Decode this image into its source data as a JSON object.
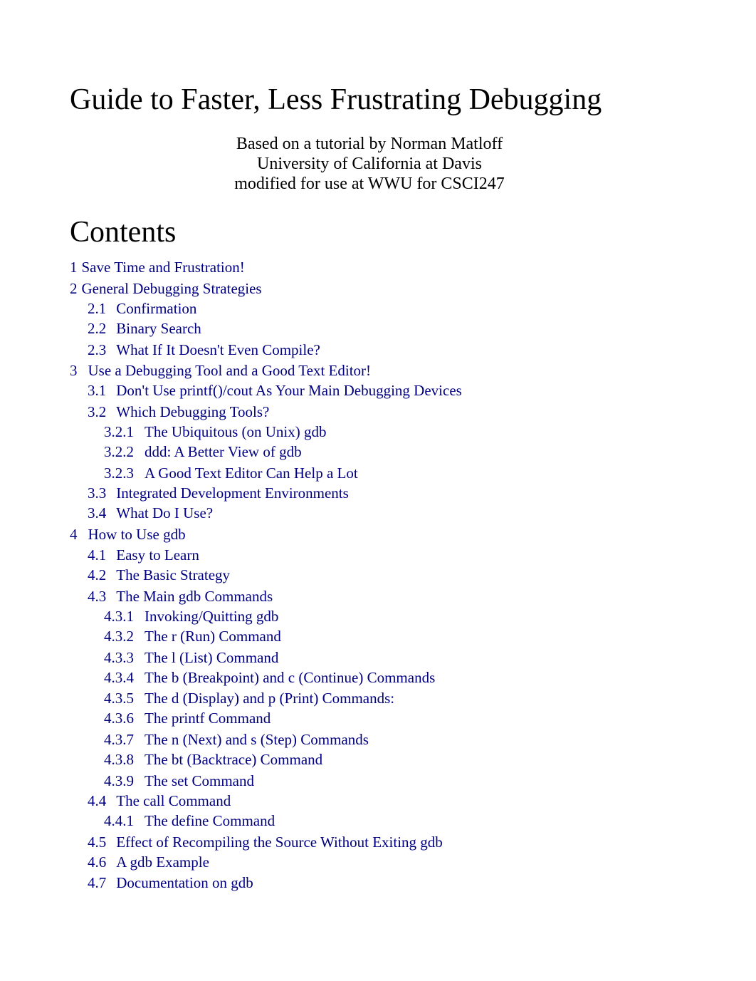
{
  "document": {
    "title": "Guide to Faster, Less Frustrating Debugging",
    "byline": [
      "Based on a tutorial by Norman Matloff",
      "University of California at Davis",
      "modified for use at WWU for CSCI247"
    ],
    "contents_heading": "Contents"
  },
  "toc": [
    {
      "num": "1",
      "label": "Save Time and Frustration!"
    },
    {
      "num": "2",
      "label": "General Debugging Strategies"
    },
    {
      "num": "2.1",
      "label": "Confirmation"
    },
    {
      "num": "2.2",
      "label": "Binary Search"
    },
    {
      "num": "2.3",
      "label": "What If It Doesn't Even Compile?"
    },
    {
      "num": "3",
      "label": "Use a Debugging Tool and a Good Text Editor!"
    },
    {
      "num": "3.1",
      "label": "Don't Use printf()/cout As Your Main Debugging Devices"
    },
    {
      "num": "3.2",
      "label": "Which Debugging Tools?"
    },
    {
      "num": "3.2.1",
      "label": "The Ubiquitous (on Unix) gdb"
    },
    {
      "num": "3.2.2",
      "label": "ddd: A Better View of gdb"
    },
    {
      "num": "3.2.3",
      "label": "A Good Text Editor Can Help a Lot"
    },
    {
      "num": "3.3",
      "label": "Integrated Development Environments"
    },
    {
      "num": "3.4",
      "label": "What Do I Use?"
    },
    {
      "num": "4",
      "label": "How to Use gdb"
    },
    {
      "num": "4.1",
      "label": "Easy to Learn"
    },
    {
      "num": "4.2",
      "label": "The Basic Strategy"
    },
    {
      "num": "4.3",
      "label": "The Main gdb Commands"
    },
    {
      "num": "4.3.1",
      "label": "Invoking/Quitting gdb"
    },
    {
      "num": "4.3.2",
      "label": "The r (Run) Command"
    },
    {
      "num": "4.3.3",
      "label": "The l (List) Command"
    },
    {
      "num": "4.3.4",
      "label": "The b (Breakpoint) and c (Continue) Commands"
    },
    {
      "num": "4.3.5",
      "label": "The d (Display) and p (Print) Commands:"
    },
    {
      "num": "4.3.6",
      "label": "The printf Command"
    },
    {
      "num": "4.3.7",
      "label": "The n (Next) and s (Step) Commands"
    },
    {
      "num": "4.3.8",
      "label": "The bt (Backtrace) Command"
    },
    {
      "num": "4.3.9",
      "label": "The set Command"
    },
    {
      "num": "4.4",
      "label": "The call Command"
    },
    {
      "num": "4.4.1",
      "label": "The define Command"
    },
    {
      "num": "4.5",
      "label": "Effect of Recompiling the Source Without Exiting gdb"
    },
    {
      "num": "4.6",
      "label": "A gdb Example"
    },
    {
      "num": "4.7",
      "label": "Documentation on gdb"
    }
  ],
  "colors": {
    "link": "#000080",
    "text": "#000000",
    "background": "#ffffff"
  }
}
